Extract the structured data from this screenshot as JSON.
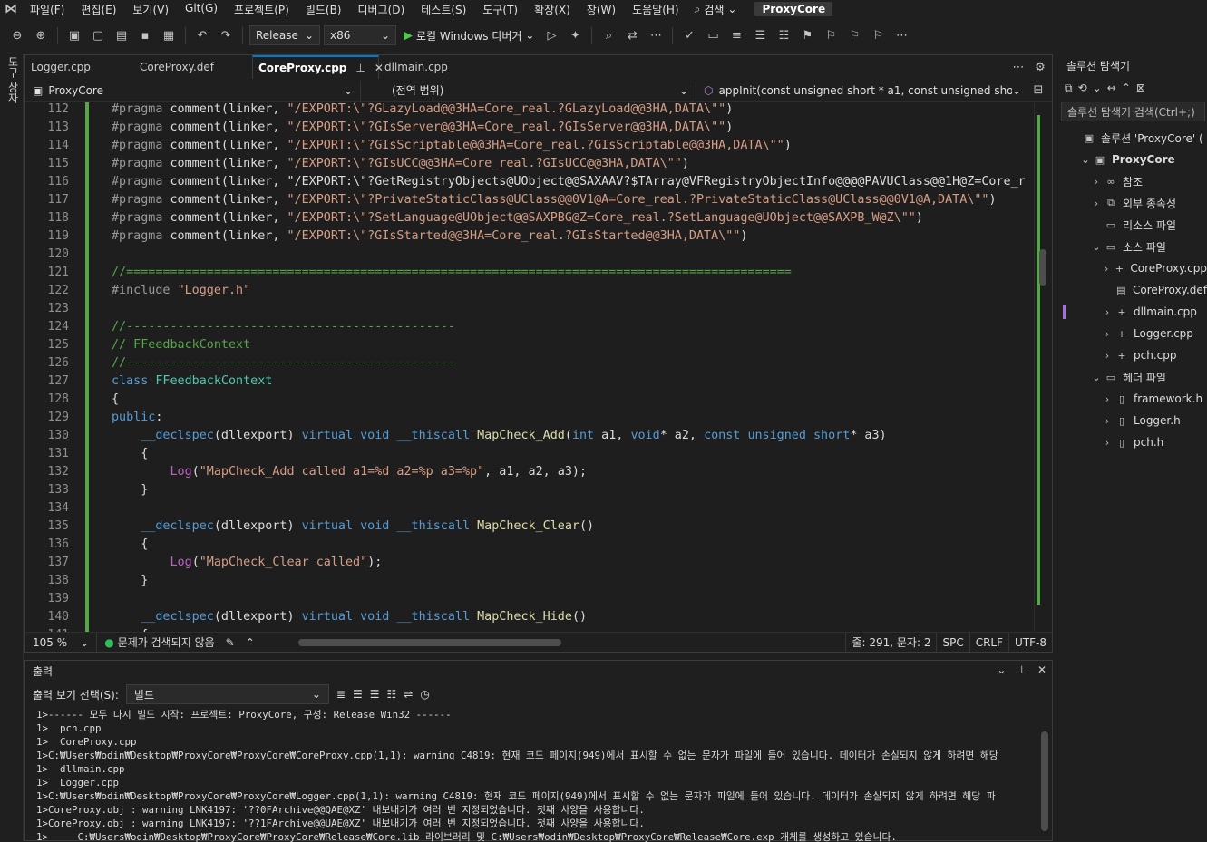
{
  "menubar": {
    "items": [
      "파일(F)",
      "편집(E)",
      "보기(V)",
      "Git(G)",
      "프로젝트(P)",
      "빌드(B)",
      "디버그(D)",
      "테스트(S)",
      "도구(T)",
      "확장(X)",
      "창(W)",
      "도움말(H)"
    ],
    "search_label": "검색",
    "title": "ProxyCore"
  },
  "toolbar": {
    "configuration": "Release",
    "platform": "x86",
    "run_label": "로컬 Windows 디버거"
  },
  "left_rail": {
    "toolbox_label": "도구 상자"
  },
  "editor": {
    "tabs": [
      {
        "label": "Logger.cpp",
        "active": false
      },
      {
        "label": "CoreProxy.def",
        "active": false
      },
      {
        "label": "CoreProxy.cpp",
        "active": true
      },
      {
        "label": "dllmain.cpp",
        "active": false
      }
    ],
    "nav": {
      "project": "ProxyCore",
      "scope": "(전역 범위)",
      "member": "appInit(const unsigned short * a1, const unsigned short *"
    },
    "lines": [
      {
        "n": "112",
        "t": "#pragma comment(linker, \"/EXPORT:\\\"?GLazyLoad@@3HA=Core_real.?GLazyLoad@@3HA,DATA\\\"\")"
      },
      {
        "n": "113",
        "t": "#pragma comment(linker, \"/EXPORT:\\\"?GIsServer@@3HA=Core_real.?GIsServer@@3HA,DATA\\\"\")"
      },
      {
        "n": "114",
        "t": "#pragma comment(linker, \"/EXPORT:\\\"?GIsScriptable@@3HA=Core_real.?GIsScriptable@@3HA,DATA\\\"\")"
      },
      {
        "n": "115",
        "t": "#pragma comment(linker, \"/EXPORT:\\\"?GIsUCC@@3HA=Core_real.?GIsUCC@@3HA,DATA\\\"\")"
      },
      {
        "n": "116",
        "t": "#pragma comment(linker, \"/EXPORT:\\\"?GetRegistryObjects@UObject@@SAXAAV?$TArray@VFRegistryObjectInfo@@@@PAVUClass@@1H@Z=Core_r"
      },
      {
        "n": "117",
        "t": "#pragma comment(linker, \"/EXPORT:\\\"?PrivateStaticClass@UClass@@0V1@A=Core_real.?PrivateStaticClass@UClass@@0V1@A,DATA\\\"\")"
      },
      {
        "n": "118",
        "t": "#pragma comment(linker, \"/EXPORT:\\\"?SetLanguage@UObject@@SAXPBG@Z=Core_real.?SetLanguage@UObject@@SAXPB_W@Z\\\"\")"
      },
      {
        "n": "119",
        "t": "#pragma comment(linker, \"/EXPORT:\\\"?GIsStarted@@3HA=Core_real.?GIsStarted@@3HA,DATA\\\"\")"
      },
      {
        "n": "120",
        "t": ""
      },
      {
        "n": "121",
        "t": "//==========================================================================================="
      },
      {
        "n": "122",
        "t": "#include \"Logger.h\""
      },
      {
        "n": "123",
        "t": ""
      },
      {
        "n": "124",
        "t": "//---------------------------------------------"
      },
      {
        "n": "125",
        "t": "// FFeedbackContext"
      },
      {
        "n": "126",
        "t": "//---------------------------------------------"
      },
      {
        "n": "127",
        "t": "class FFeedbackContext"
      },
      {
        "n": "128",
        "t": "{"
      },
      {
        "n": "129",
        "t": "public:"
      },
      {
        "n": "130",
        "t": "    __declspec(dllexport) virtual void __thiscall MapCheck_Add(int a1, void* a2, const unsigned short* a3)"
      },
      {
        "n": "131",
        "t": "    {"
      },
      {
        "n": "132",
        "t": "        Log(\"MapCheck_Add called a1=%d a2=%p a3=%p\", a1, a2, a3);"
      },
      {
        "n": "133",
        "t": "    }"
      },
      {
        "n": "134",
        "t": ""
      },
      {
        "n": "135",
        "t": "    __declspec(dllexport) virtual void __thiscall MapCheck_Clear()"
      },
      {
        "n": "136",
        "t": "    {"
      },
      {
        "n": "137",
        "t": "        Log(\"MapCheck_Clear called\");"
      },
      {
        "n": "138",
        "t": "    }"
      },
      {
        "n": "139",
        "t": ""
      },
      {
        "n": "140",
        "t": "    __declspec(dllexport) virtual void __thiscall MapCheck_Hide()"
      },
      {
        "n": "141",
        "t": "    {"
      }
    ],
    "status": {
      "zoom": "105 %",
      "issues": "문제가 검색되지 않음",
      "position": "줄: 291, 문자: 2",
      "whitespace": "SPC",
      "line_ending": "CRLF",
      "encoding": "UTF-8"
    }
  },
  "solution_explorer": {
    "title": "솔루션 탐색기",
    "search_placeholder": "솔루션 탐색기 검색(Ctrl+;)",
    "tree": [
      {
        "label": "솔루션 'ProxyCore' (",
        "indent": 0,
        "arrow": "",
        "icon": "solution-icon"
      },
      {
        "label": "ProxyCore",
        "indent": 1,
        "arrow": "⌄",
        "icon": "project-icon",
        "bold": true
      },
      {
        "label": "참조",
        "indent": 2,
        "arrow": "›",
        "icon": "references-icon"
      },
      {
        "label": "외부 종속성",
        "indent": 2,
        "arrow": "›",
        "icon": "external-deps-icon"
      },
      {
        "label": "리소스 파일",
        "indent": 2,
        "arrow": "",
        "icon": "folder-icon"
      },
      {
        "label": "소스 파일",
        "indent": 2,
        "arrow": "⌄",
        "icon": "folder-icon"
      },
      {
        "label": "CoreProxy.cpp",
        "indent": 3,
        "arrow": "›",
        "icon": "cpp-file-icon"
      },
      {
        "label": "CoreProxy.def",
        "indent": 3,
        "arrow": "",
        "icon": "def-file-icon"
      },
      {
        "label": "dllmain.cpp",
        "indent": 3,
        "arrow": "›",
        "icon": "cpp-file-icon",
        "selected": true
      },
      {
        "label": "Logger.cpp",
        "indent": 3,
        "arrow": "›",
        "icon": "cpp-file-icon"
      },
      {
        "label": "pch.cpp",
        "indent": 3,
        "arrow": "›",
        "icon": "cpp-file-icon"
      },
      {
        "label": "헤더 파일",
        "indent": 2,
        "arrow": "⌄",
        "icon": "folder-icon"
      },
      {
        "label": "framework.h",
        "indent": 3,
        "arrow": "›",
        "icon": "header-file-icon"
      },
      {
        "label": "Logger.h",
        "indent": 3,
        "arrow": "›",
        "icon": "header-file-icon"
      },
      {
        "label": "pch.h",
        "indent": 3,
        "arrow": "›",
        "icon": "header-file-icon"
      }
    ]
  },
  "output": {
    "title": "출력",
    "source_label": "출력 보기 선택(S):",
    "source_value": "빌드",
    "lines": [
      "1>------ 모두 다시 빌드 시작: 프로젝트: ProxyCore, 구성: Release Win32 ------",
      "1>  pch.cpp",
      "1>  CoreProxy.cpp",
      "1>C:₩Users₩odin₩Desktop₩ProxyCore₩ProxyCore₩CoreProxy.cpp(1,1): warning C4819: 현재 코드 페이지(949)에서 표시할 수 없는 문자가 파일에 들어 있습니다. 데이터가 손실되지 않게 하려면 해당",
      "1>  dllmain.cpp",
      "1>  Logger.cpp",
      "1>C:₩Users₩odin₩Desktop₩ProxyCore₩ProxyCore₩Logger.cpp(1,1): warning C4819: 현재 코드 페이지(949)에서 표시할 수 없는 문자가 파일에 들어 있습니다. 데이터가 손실되지 않게 하려면 해당 파",
      "1>CoreProxy.obj : warning LNK4197: '??0FArchive@@QAE@XZ' 내보내기가 여러 번 지정되었습니다. 첫째 사양을 사용합니다.",
      "1>CoreProxy.obj : warning LNK4197: '??1FArchive@@UAE@XZ' 내보내기가 여러 번 지정되었습니다. 첫째 사양을 사용합니다.",
      "1>     C:₩Users₩odin₩Desktop₩ProxyCore₩ProxyCore₩Release₩Core.lib 라이브러리 및 C:₩Users₩odin₩Desktop₩ProxyCore₩Release₩Core.exp 개체를 생성하고 있습니다."
    ]
  }
}
